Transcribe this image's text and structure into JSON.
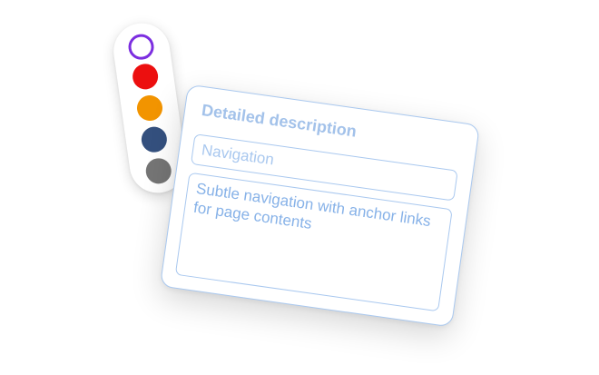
{
  "palette": {
    "swatches": [
      {
        "name": "purple-outline",
        "color": "#7c2ee0",
        "selected": true
      },
      {
        "name": "red",
        "color": "#ec0f0f",
        "selected": false
      },
      {
        "name": "orange",
        "color": "#f29400",
        "selected": false
      },
      {
        "name": "navy",
        "color": "#34507e",
        "selected": false
      },
      {
        "name": "gray",
        "color": "#757575",
        "selected": false
      }
    ]
  },
  "card": {
    "title": "Detailed description",
    "title_field_value": "Navigation",
    "description_field_value": "Subtle navigation with anchor links for page contents",
    "accent_color": "#a9c8ef",
    "text_color": "#87b2e8"
  }
}
